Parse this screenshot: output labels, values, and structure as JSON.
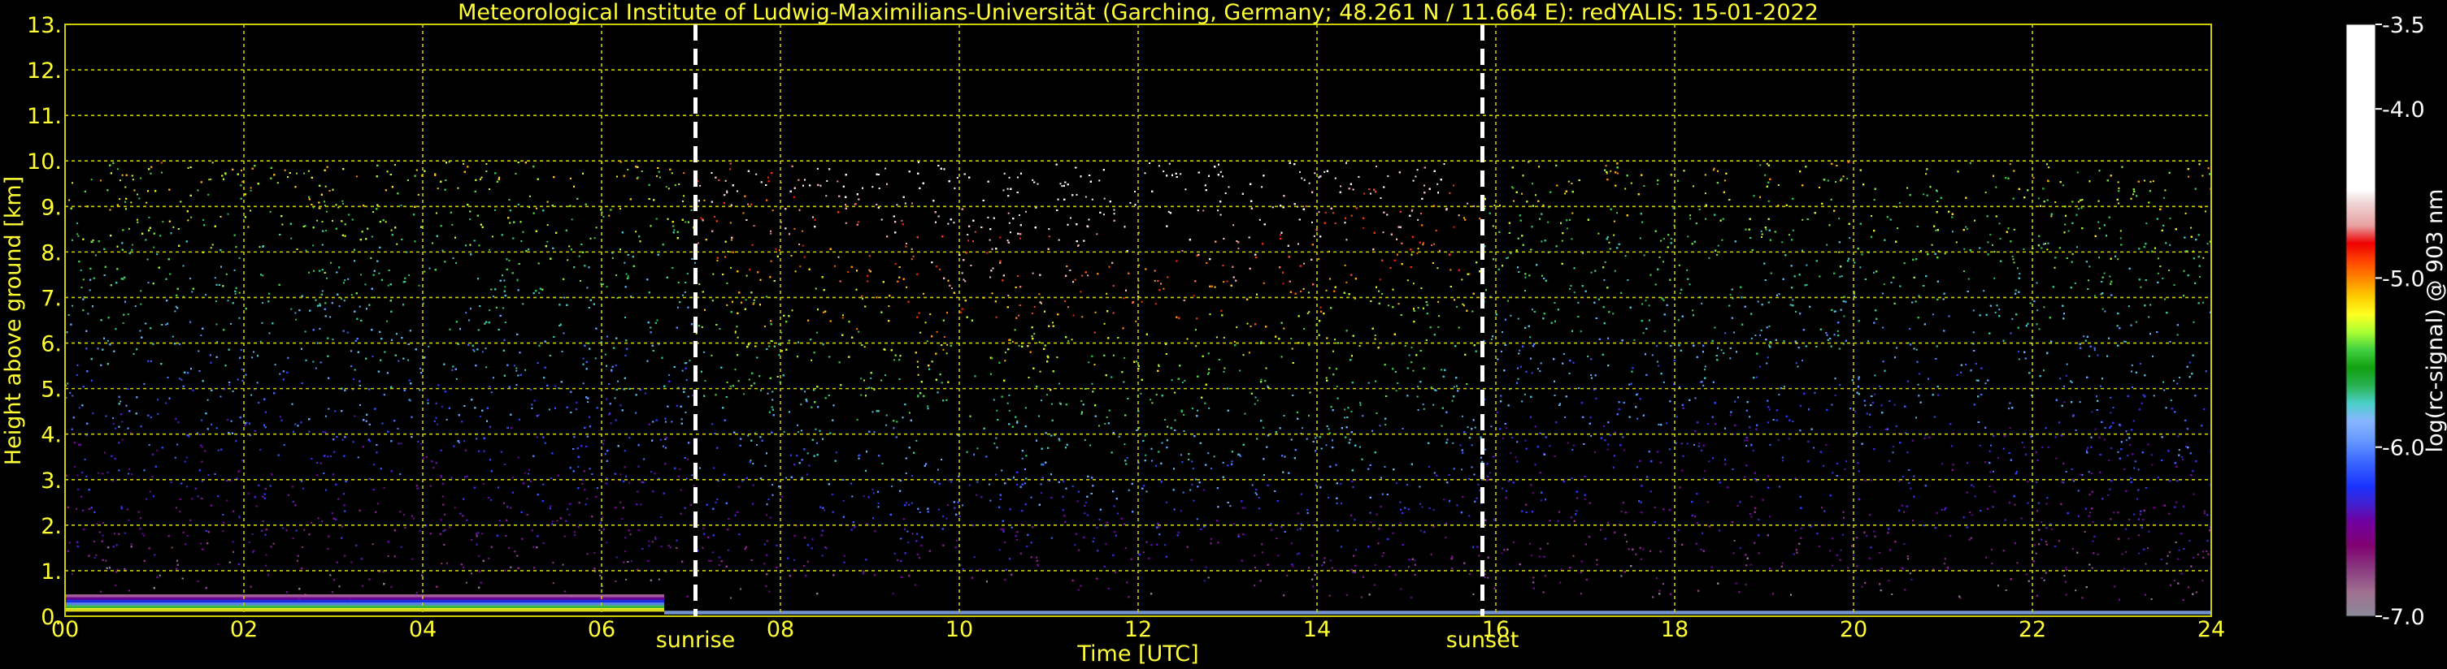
{
  "chart_data": {
    "type": "heatmap",
    "title": "Meteorological Institute of Ludwig-Maximilians-Universität (Garching, Germany; 48.261 N / 11.664 E):    redYALIS: 15-01-2022",
    "xlabel": "Time [UTC]",
    "ylabel": "Height above ground [km]",
    "xlim": [
      0,
      24
    ],
    "ylim": [
      0,
      13
    ],
    "x_ticks": [
      0,
      2,
      4,
      6,
      8,
      10,
      12,
      14,
      16,
      18,
      20,
      22,
      24
    ],
    "x_tick_labels": [
      "00",
      "02",
      "04",
      "06",
      "08",
      "10",
      "12",
      "14",
      "16",
      "18",
      "20",
      "22",
      "24"
    ],
    "y_ticks": [
      0,
      1,
      2,
      3,
      4,
      5,
      6,
      7,
      8,
      9,
      10,
      11,
      12,
      13
    ],
    "y_tick_labels": [
      "0.",
      "1.",
      "2.",
      "3.",
      "4.",
      "5.",
      "6.",
      "7.",
      "8.",
      "9.",
      "10.",
      "11.",
      "12.",
      "13."
    ],
    "grid": true,
    "data_top_km": 10,
    "markers": [
      {
        "label": "sunrise",
        "x": 7.05
      },
      {
        "label": "sunset",
        "x": 15.85
      }
    ],
    "colorbar": {
      "label": "log(rc-signal) @ 903 nm",
      "range": [
        -7.0,
        -3.5
      ],
      "tick_values": [
        -7.0,
        -6.0,
        -5.0,
        -4.0,
        -3.5
      ],
      "tick_labels": [
        "-7.0",
        "-6.0",
        "-5.0",
        "-4.0",
        "-3.5"
      ]
    },
    "colors": {
      "text": "#ffff33",
      "grid": "#cccc00",
      "marker_line": "#ffffff",
      "colorbar_text": "#ffffff",
      "background": "#000000"
    }
  }
}
